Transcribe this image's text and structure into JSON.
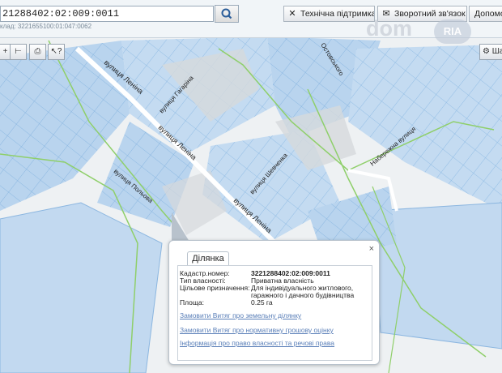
{
  "search": {
    "value": "21288402:02:009:0011",
    "hint": "клад: 3221655100:01:047:0062"
  },
  "toolbar": {
    "support_label": "Технічна підтримка",
    "feedback_label": "Зворотний зв'язок",
    "help_label": "Допомога"
  },
  "watermark": {
    "text": "dom",
    "badge": "RIA"
  },
  "map_tools": {
    "layers_label": "Ша"
  },
  "streets": {
    "lenina_1": "вулиця Леніна",
    "lenina_2": "вулиця Леніна",
    "lenina_3": "вулиця Леніна",
    "gagarina": "вулиця Гагаріна",
    "polova": "вулиця Польова",
    "shevchenka": "вулиця Шевченка",
    "naberezhna": "Набережна вулиця",
    "ostovskoho": "Остовського"
  },
  "popup": {
    "tab": "Ділянка",
    "close": "×",
    "fields": [
      {
        "label": "Кадастр.номер:",
        "value": "3221288402:02:009:0011",
        "bold": true
      },
      {
        "label": "Тип власності:",
        "value": "Приватна власність"
      },
      {
        "label": "Цільове призначення:",
        "value": "Для індивідуального житлового,"
      },
      {
        "label": "",
        "value": "гаражного і дачного будівництва"
      },
      {
        "label": "Площа:",
        "value": "0.25 га"
      }
    ],
    "links": [
      "Замовити Витяг про земельну ділянку",
      "Замовити Витяг про нормативну грошову оцінку",
      "Інформація про право власності та речові права"
    ]
  }
}
